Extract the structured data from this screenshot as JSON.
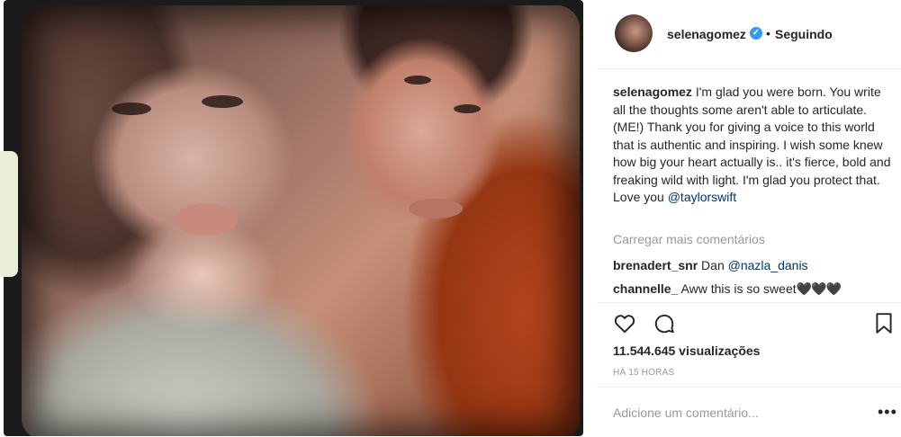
{
  "post": {
    "username": "selenagomez",
    "separator": "•",
    "follow_status": "Seguindo"
  },
  "caption": {
    "username": "selenagomez",
    "text": "I'm glad you were born. You write all the thoughts some aren't able to articulate. (ME!) Thank you for giving a voice to this world that is authentic and inspiring. I wish some knew how big your heart actually is.. it's fierce, bold and freaking wild with light. I'm glad you protect that. Love you",
    "mention": "@taylorswift"
  },
  "comments": {
    "load_more": "Carregar mais comentários",
    "items": [
      {
        "username": "brenadert_snr",
        "text": "Dan",
        "mention": "@nazla_danis"
      },
      {
        "username": "channelle_",
        "text": "Aww this is so sweet",
        "emoji": [
          "🖤",
          "🖤",
          "🖤"
        ]
      }
    ]
  },
  "stats": {
    "views": "11.544.645 visualizações",
    "time": "HÁ 15 HORAS"
  },
  "add_comment": {
    "placeholder": "Adicione um comentário..."
  },
  "icons": {
    "verified": "verified-badge-icon",
    "like": "heart-icon",
    "comment": "comment-bubble-icon",
    "save": "bookmark-icon",
    "more": "more-options-icon"
  },
  "colors": {
    "verified_blue": "#3897f0",
    "mention_blue": "#003569",
    "muted_gray": "#999999",
    "text": "#262626"
  }
}
